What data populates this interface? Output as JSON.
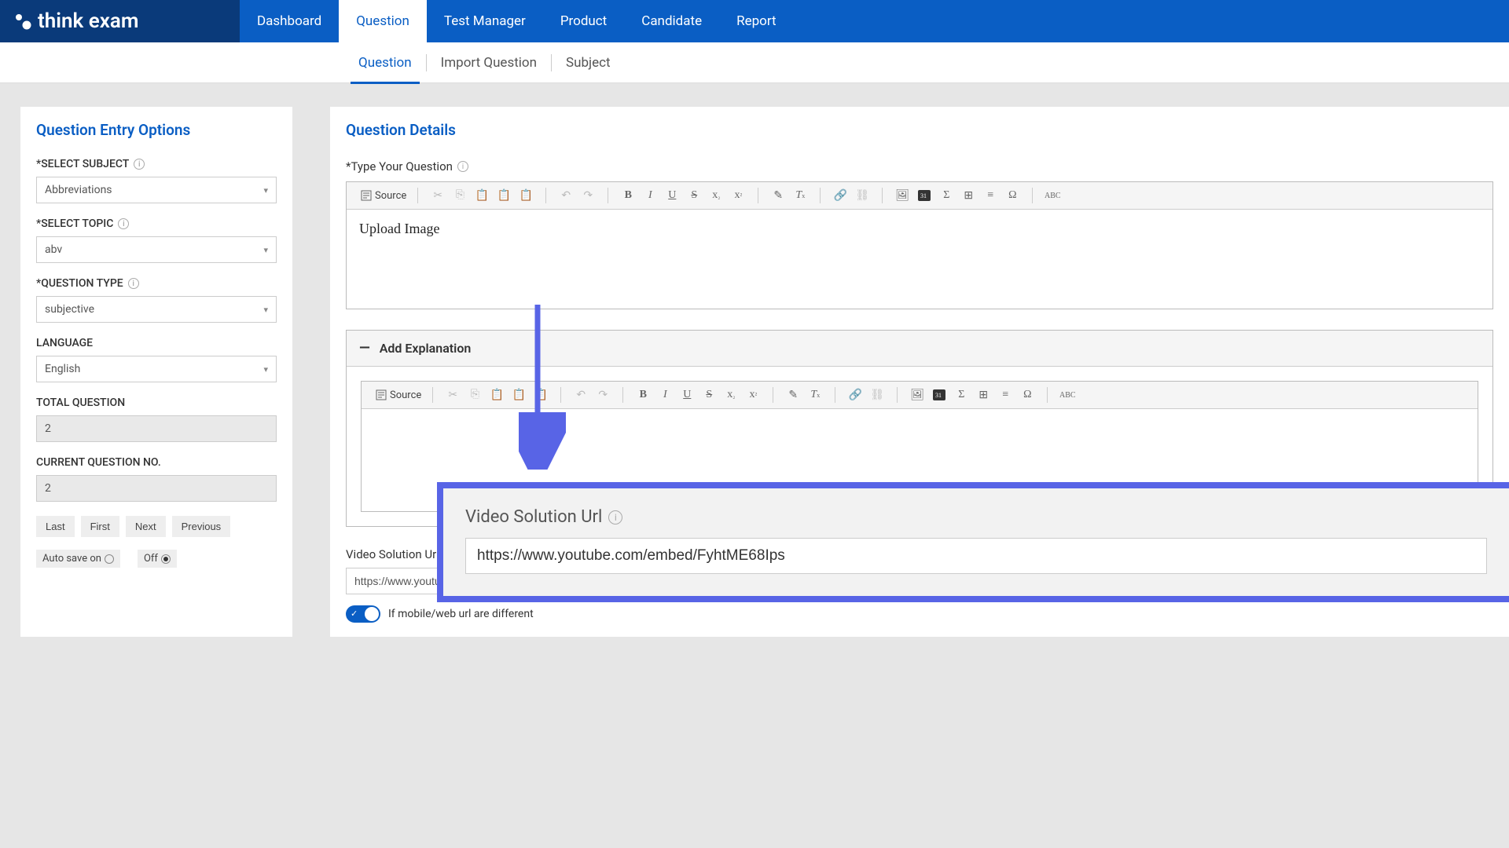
{
  "logo_text": "think exam",
  "nav": {
    "items": [
      "Dashboard",
      "Question",
      "Test Manager",
      "Product",
      "Candidate",
      "Report"
    ],
    "active": 1
  },
  "subnav": {
    "items": [
      "Question",
      "Import Question",
      "Subject"
    ],
    "active": 0
  },
  "left": {
    "title": "Question Entry Options",
    "subject_label": "*SELECT SUBJECT",
    "subject_value": "Abbreviations",
    "topic_label": "*SELECT TOPIC",
    "topic_value": "abv",
    "qtype_label": "*QUESTION TYPE",
    "qtype_value": "subjective",
    "language_label": "LANGUAGE",
    "language_value": "English",
    "total_label": "TOTAL QUESTION",
    "total_value": "2",
    "current_label": "CURRENT QUESTION NO.",
    "current_value": "2",
    "buttons": [
      "Last",
      "First",
      "Next",
      "Previous"
    ],
    "autosave_on": "Auto save on",
    "autosave_off": "Off"
  },
  "right": {
    "title": "Question Details",
    "question_label": "*Type Your Question",
    "source_label": "Source",
    "editor_content": "Upload Image",
    "explain_title": "Add Explanation",
    "video_label": "Video Solution Url",
    "video_value": "https://www.youtub",
    "toggle_label": "If mobile/web url are different"
  },
  "callout": {
    "label": "Video Solution Url",
    "value": "https://www.youtube.com/embed/FyhtME68Ips"
  }
}
